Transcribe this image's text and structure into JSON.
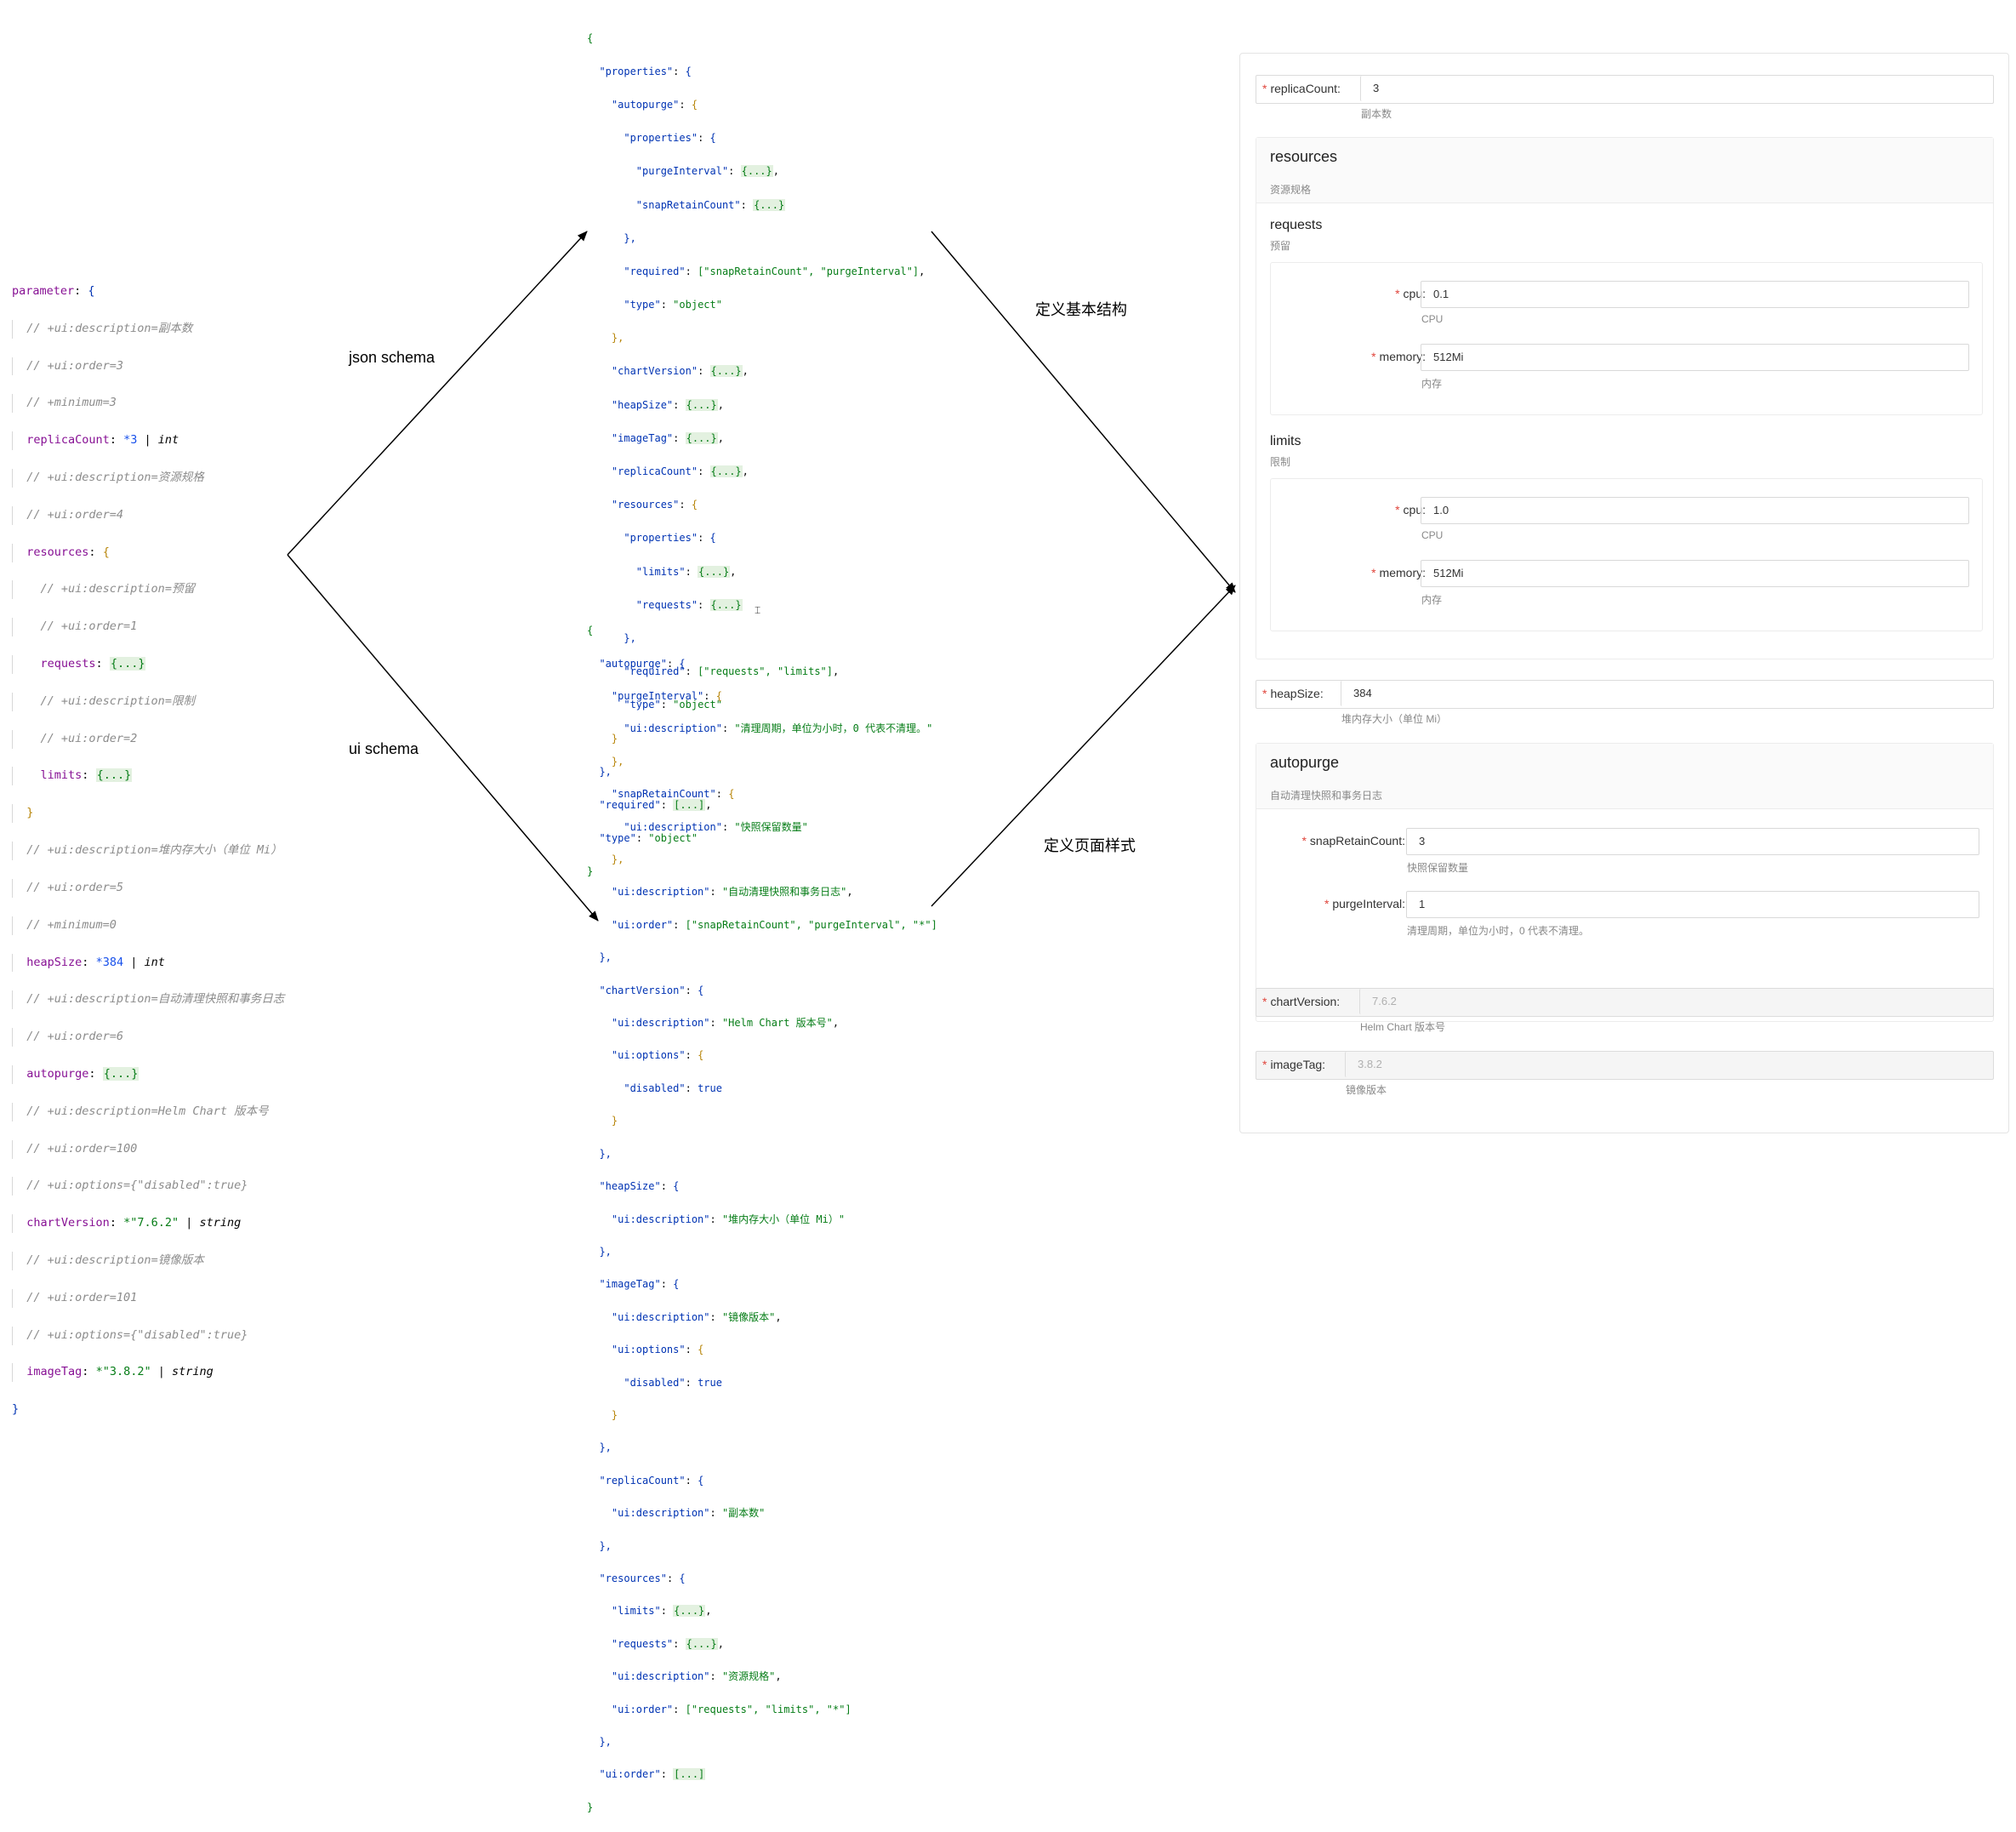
{
  "left_code": {
    "l1": "parameter",
    "l2": "// +ui:description=副本数",
    "l3": "// +ui:order=3",
    "l4": "// +minimum=3",
    "l5_key": "replicaCount",
    "l5_val": "*3",
    "l5_type": "int",
    "l6": "// +ui:description=资源规格",
    "l7": "// +ui:order=4",
    "l8_key": "resources",
    "l9": "// +ui:description=预留",
    "l10": "// +ui:order=1",
    "l11_key": "requests",
    "l11_fold": "{...}",
    "l12": "// +ui:description=限制",
    "l13": "// +ui:order=2",
    "l14_key": "limits",
    "l14_fold": "{...}",
    "l16": "// +ui:description=堆内存大小（单位 Mi）",
    "l17": "// +ui:order=5",
    "l18": "// +minimum=0",
    "l19_key": "heapSize",
    "l19_val": "*384",
    "l19_type": "int",
    "l20": "// +ui:description=自动清理快照和事务日志",
    "l21": "// +ui:order=6",
    "l22_key": "autopurge",
    "l22_fold": "{...}",
    "l23": "// +ui:description=Helm Chart 版本号",
    "l24": "// +ui:order=100",
    "l25": "// +ui:options={\"disabled\":true}",
    "l26_key": "chartVersion",
    "l26_val": "*\"7.6.2\"",
    "l26_type": "string",
    "l27": "// +ui:description=镜像版本",
    "l28": "// +ui:order=101",
    "l29": "// +ui:options={\"disabled\":true}",
    "l30_key": "imageTag",
    "l30_val": "*\"3.8.2\"",
    "l30_type": "string"
  },
  "json_schema": {
    "properties": "\"properties\"",
    "autopurge": "\"autopurge\"",
    "purgeInterval": "\"purgeInterval\"",
    "snapRetainCount": "\"snapRetainCount\"",
    "required_ap": "[\"snapRetainCount\", \"purgeInterval\"]",
    "required": "\"required\"",
    "type": "\"type\"",
    "object": "\"object\"",
    "chartVersion": "\"chartVersion\"",
    "heapSize": "\"heapSize\"",
    "imageTag": "\"imageTag\"",
    "replicaCount": "\"replicaCount\"",
    "resources": "\"resources\"",
    "limits": "\"limits\"",
    "requests": "\"requests\"",
    "required_res": "[\"requests\", \"limits\"]",
    "fold_obj": "{...}",
    "fold_arr": "[...]"
  },
  "ui_schema": {
    "autopurge": "\"autopurge\"",
    "purgeInterval": "\"purgeInterval\"",
    "ui_description": "\"ui:description\"",
    "purge_desc": "\"清理周期，单位为小时，0 代表不清理。\"",
    "snapRetainCount": "\"snapRetainCount\"",
    "snap_desc": "\"快照保留数量\"",
    "autopurge_desc": "\"自动清理快照和事务日志\"",
    "ui_order": "\"ui:order\"",
    "autopurge_order": "[\"snapRetainCount\", \"purgeInterval\", \"*\"]",
    "chartVersion": "\"chartVersion\"",
    "chart_desc": "\"Helm Chart 版本号\"",
    "ui_options": "\"ui:options\"",
    "disabled": "\"disabled\"",
    "true": "true",
    "heapSize": "\"heapSize\"",
    "heap_desc": "\"堆内存大小（单位 Mi）\"",
    "imageTag": "\"imageTag\"",
    "image_desc": "\"镜像版本\"",
    "replicaCount": "\"replicaCount\"",
    "replica_desc": "\"副本数\"",
    "resources": "\"resources\"",
    "limits": "\"limits\"",
    "requests": "\"requests\"",
    "res_desc": "\"资源规格\"",
    "res_order": "[\"requests\", \"limits\", \"*\"]",
    "fold_obj": "{...}",
    "fold_arr": "[...]"
  },
  "labels": {
    "json_schema": "json schema",
    "ui_schema": "ui schema",
    "define_structure": "定义基本结构",
    "define_style": "定义页面样式"
  },
  "form": {
    "replicaCount": {
      "label": "replicaCount:",
      "value": "3",
      "help": "副本数"
    },
    "resources": {
      "title": "resources",
      "desc": "资源规格",
      "requests": {
        "title": "requests",
        "desc": "预留",
        "cpu": {
          "label": "cpu:",
          "value": "0.1",
          "help": "CPU"
        },
        "memory": {
          "label": "memory:",
          "value": "512Mi",
          "help": "内存"
        }
      },
      "limits": {
        "title": "limits",
        "desc": "限制",
        "cpu": {
          "label": "cpu:",
          "value": "1.0",
          "help": "CPU"
        },
        "memory": {
          "label": "memory:",
          "value": "512Mi",
          "help": "内存"
        }
      }
    },
    "heapSize": {
      "label": "heapSize:",
      "value": "384",
      "help": "堆内存大小（单位 Mi）"
    },
    "autopurge": {
      "title": "autopurge",
      "desc": "自动清理快照和事务日志",
      "snapRetainCount": {
        "label": "snapRetainCount:",
        "value": "3",
        "help": "快照保留数量"
      },
      "purgeInterval": {
        "label": "purgeInterval:",
        "value": "1",
        "help": "清理周期，单位为小时，0 代表不清理。"
      }
    },
    "chartVersion": {
      "label": "chartVersion:",
      "value": "7.6.2",
      "help": "Helm Chart 版本号"
    },
    "imageTag": {
      "label": "imageTag:",
      "value": "3.8.2",
      "help": "镜像版本"
    },
    "required_mark": "*"
  }
}
